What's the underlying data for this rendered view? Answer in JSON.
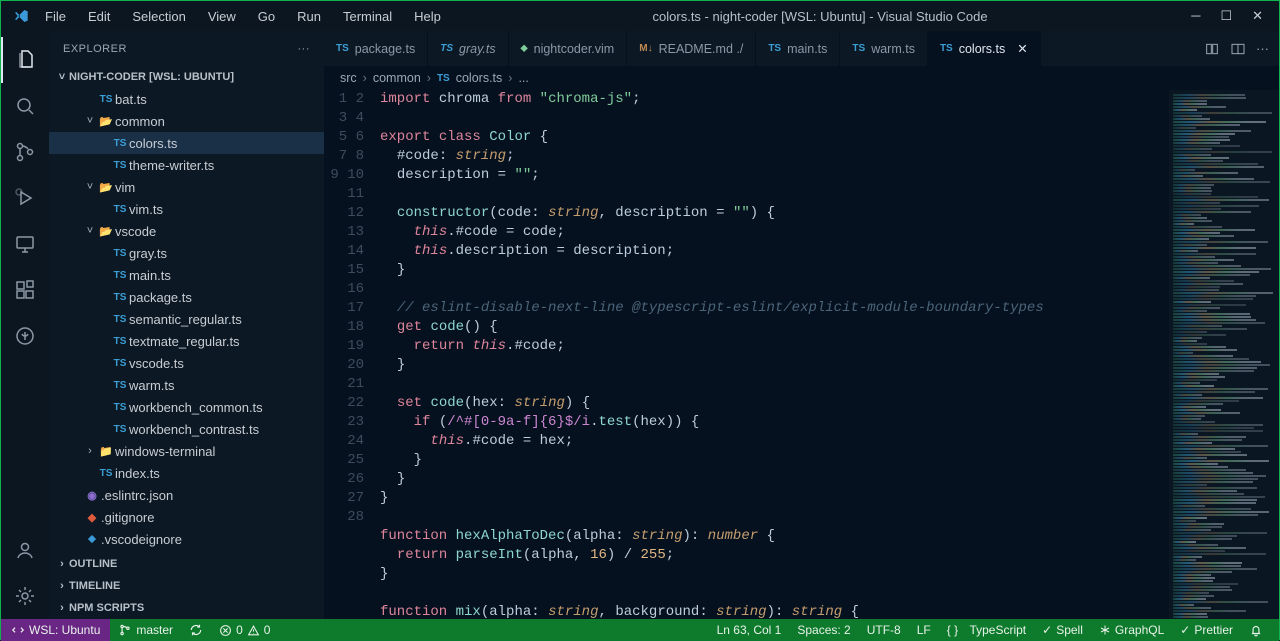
{
  "title": "colors.ts - night-coder [WSL: Ubuntu] - Visual Studio Code",
  "menu": [
    "File",
    "Edit",
    "Selection",
    "View",
    "Go",
    "Run",
    "Terminal",
    "Help"
  ],
  "explorer": {
    "title": "EXPLORER",
    "root": "NIGHT-CODER [WSL: UBUNTU]",
    "sections": [
      "OUTLINE",
      "TIMELINE",
      "NPM SCRIPTS"
    ]
  },
  "tree": [
    {
      "d": 1,
      "t": "ts",
      "label": "bat.ts"
    },
    {
      "d": 1,
      "t": "folder-open",
      "label": "common",
      "chev": "v"
    },
    {
      "d": 2,
      "t": "ts",
      "label": "colors.ts",
      "sel": true
    },
    {
      "d": 2,
      "t": "ts",
      "label": "theme-writer.ts"
    },
    {
      "d": 1,
      "t": "folder-open",
      "label": "vim",
      "chev": "v"
    },
    {
      "d": 2,
      "t": "ts",
      "label": "vim.ts"
    },
    {
      "d": 1,
      "t": "folder-blue-open",
      "label": "vscode",
      "chev": "v"
    },
    {
      "d": 2,
      "t": "ts",
      "label": "gray.ts"
    },
    {
      "d": 2,
      "t": "ts",
      "label": "main.ts"
    },
    {
      "d": 2,
      "t": "ts",
      "label": "package.ts"
    },
    {
      "d": 2,
      "t": "ts",
      "label": "semantic_regular.ts"
    },
    {
      "d": 2,
      "t": "ts",
      "label": "textmate_regular.ts"
    },
    {
      "d": 2,
      "t": "ts",
      "label": "vscode.ts"
    },
    {
      "d": 2,
      "t": "ts",
      "label": "warm.ts"
    },
    {
      "d": 2,
      "t": "ts",
      "label": "workbench_common.ts"
    },
    {
      "d": 2,
      "t": "ts",
      "label": "workbench_contrast.ts"
    },
    {
      "d": 1,
      "t": "folder",
      "label": "windows-terminal",
      "chev": ">"
    },
    {
      "d": 1,
      "t": "ts",
      "label": "index.ts"
    },
    {
      "d": 0,
      "t": "eslint",
      "label": ".eslintrc.json"
    },
    {
      "d": 0,
      "t": "git",
      "label": ".gitignore"
    },
    {
      "d": 0,
      "t": "vsignore",
      "label": ".vscodeignore"
    }
  ],
  "tabs": [
    {
      "icon": "ts",
      "label": "package.ts"
    },
    {
      "icon": "ts",
      "label": "gray.ts",
      "italic": true
    },
    {
      "icon": "vim",
      "label": "nightcoder.vim"
    },
    {
      "icon": "md",
      "label": "README.md ./"
    },
    {
      "icon": "ts",
      "label": "main.ts"
    },
    {
      "icon": "ts",
      "label": "warm.ts"
    },
    {
      "icon": "ts",
      "label": "colors.ts",
      "active": true,
      "close": true
    }
  ],
  "breadcrumb": [
    "src",
    "common",
    "colors.ts",
    "..."
  ],
  "code_lines": 28,
  "statusbar": {
    "remote": "WSL: Ubuntu",
    "branch": "master",
    "errors": "0",
    "warnings": "0",
    "lncol": "Ln 63, Col 1",
    "spaces": "Spaces: 2",
    "encoding": "UTF-8",
    "eol": "LF",
    "lang": "TypeScript",
    "spell": "Spell",
    "graphql": "GraphQL",
    "prettier": "Prettier"
  }
}
